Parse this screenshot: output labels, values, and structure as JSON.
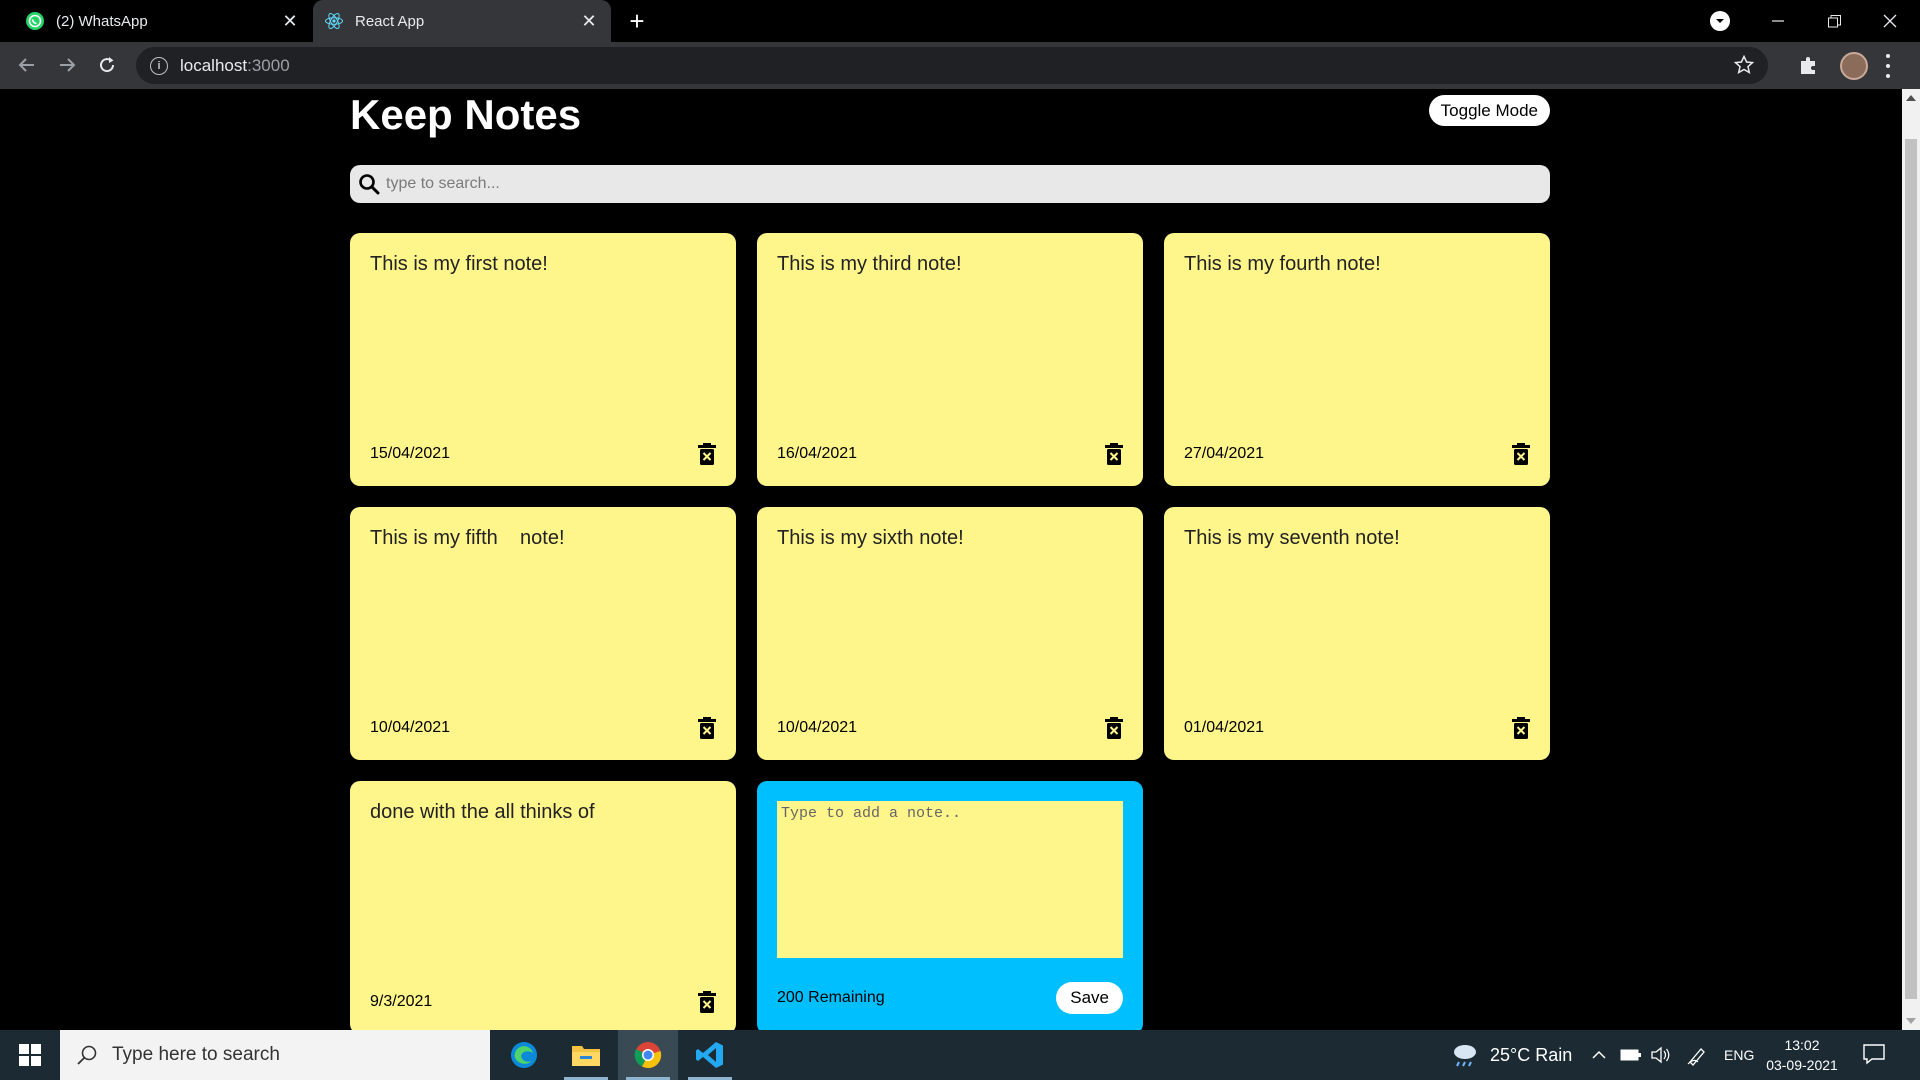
{
  "browser": {
    "tabs": [
      {
        "title": "(2) WhatsApp",
        "icon": "whatsapp-icon"
      },
      {
        "title": "React App",
        "icon": "react-icon"
      }
    ],
    "url_host": "localhost",
    "url_port": ":3000"
  },
  "app": {
    "title": "Keep Notes",
    "toggle_label": "Toggle Mode",
    "search_placeholder": "type to search...",
    "colors": {
      "note": "#fef68a",
      "new_note": "#00bfff",
      "background": "#000000"
    },
    "notes": [
      {
        "text": "This is my first note!",
        "date": "15/04/2021"
      },
      {
        "text": "This is my third note!",
        "date": "16/04/2021"
      },
      {
        "text": "This is my fourth note!",
        "date": "27/04/2021"
      },
      {
        "text": "This is my fifth    note!",
        "date": "10/04/2021"
      },
      {
        "text": "This is my sixth note!",
        "date": "10/04/2021"
      },
      {
        "text": "This is my seventh note!",
        "date": "01/04/2021"
      },
      {
        "text": "done with the all thinks of",
        "date": "9/3/2021"
      }
    ],
    "new_note": {
      "placeholder": "Type to add a note..",
      "remaining": "200 Remaining",
      "save_label": "Save"
    }
  },
  "taskbar": {
    "search_placeholder": "Type here to search",
    "weather": "25°C  Rain",
    "language": "ENG",
    "time": "13:02",
    "date": "03-09-2021"
  }
}
